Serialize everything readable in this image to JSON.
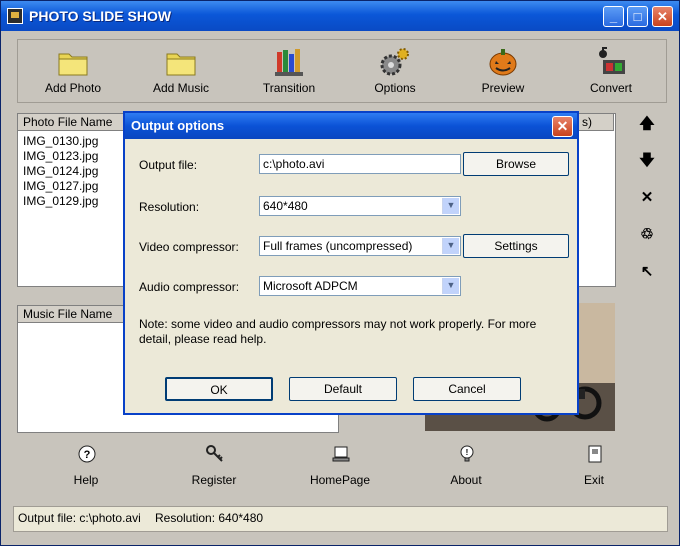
{
  "window": {
    "title": "PHOTO SLIDE SHOW"
  },
  "toolbar": {
    "items": [
      {
        "label": "Add Photo",
        "icon": "folder-icon"
      },
      {
        "label": "Add Music",
        "icon": "folder-icon"
      },
      {
        "label": "Transition",
        "icon": "pencils-icon"
      },
      {
        "label": "Options",
        "icon": "gears-icon"
      },
      {
        "label": "Preview",
        "icon": "pumpkin-icon"
      },
      {
        "label": "Convert",
        "icon": "film-icon"
      }
    ]
  },
  "photo_list": {
    "column": "Photo File Name",
    "hidden_col_fragment": "s)",
    "files": [
      "IMG_0130.jpg",
      "IMG_0123.jpg",
      "IMG_0124.jpg",
      "IMG_0127.jpg",
      "IMG_0129.jpg"
    ]
  },
  "music_list": {
    "column": "Music File Name"
  },
  "side_buttons": [
    "up-arrow-icon",
    "down-arrow-icon",
    "delete-icon",
    "clear-icon",
    "undo-icon"
  ],
  "bottom": {
    "help": "Help",
    "register": "Register",
    "homepage": "HomePage",
    "about": "About",
    "exit": "Exit"
  },
  "status": {
    "output": "Output file: c:\\photo.avi",
    "resolution": "Resolution: 640*480"
  },
  "dialog": {
    "title": "Output options",
    "output_file_label": "Output file:",
    "output_file_value": "c:\\photo.avi",
    "browse": "Browse",
    "resolution_label": "Resolution:",
    "resolution_value": "640*480",
    "video_label": "Video compressor:",
    "video_value": "Full frames (uncompressed)",
    "settings": "Settings",
    "audio_label": "Audio compressor:",
    "audio_value": "Microsoft ADPCM",
    "note": "Note: some video and audio compressors may not work properly. For more detail, please read help.",
    "ok": "OK",
    "default": "Default",
    "cancel": "Cancel"
  },
  "colors": {
    "titlebar": "#0b57d8",
    "dialog_border": "#0841c8",
    "face": "#c8c4bc",
    "close": "#c9421c"
  }
}
